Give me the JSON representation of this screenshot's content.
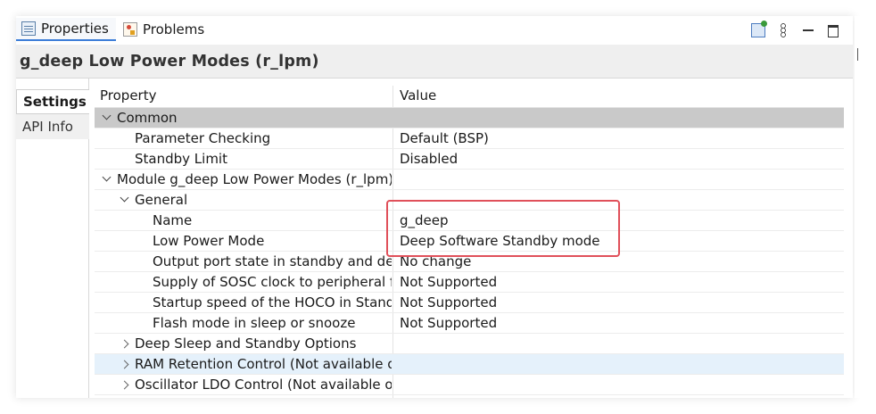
{
  "tabs": {
    "properties": "Properties",
    "problems": "Problems"
  },
  "toolbar_icons": [
    "pin-icon",
    "view-menu-icon",
    "minimize-icon",
    "maximize-icon"
  ],
  "title": "g_deep Low Power Modes (r_lpm)",
  "side_tabs": [
    "Settings",
    "API Info"
  ],
  "table": {
    "headers": [
      "Property",
      "Value"
    ],
    "rows": [
      {
        "name": "Common",
        "value": ""
      },
      {
        "name": "Parameter Checking",
        "value": "Default (BSP)"
      },
      {
        "name": "Standby Limit",
        "value": "Disabled"
      },
      {
        "name": "Module g_deep Low Power Modes (r_lpm)",
        "value": ""
      },
      {
        "name": "General",
        "value": ""
      },
      {
        "name": "Name",
        "value": "g_deep"
      },
      {
        "name": "Low Power Mode",
        "value": "Deep Software Standby mode"
      },
      {
        "name": "Output port state in standby and dee",
        "value": "No change"
      },
      {
        "name": "Supply of SOSC clock to peripheral fu",
        "value": "Not Supported"
      },
      {
        "name": "Startup speed of the HOCO in Standb",
        "value": "Not Supported"
      },
      {
        "name": "Flash mode in sleep or snooze",
        "value": "Not Supported"
      },
      {
        "name": "Deep Sleep and Standby Options",
        "value": ""
      },
      {
        "name": "RAM Retention Control (Not available o",
        "value": ""
      },
      {
        "name": "Oscillator LDO Control (Not available on",
        "value": ""
      }
    ]
  },
  "colors": {
    "category_row": "#c9c9c9",
    "selected_row": "#e5f1fb",
    "highlight_box": "#e0505a",
    "active_tab_underline": "#3c7dd8"
  }
}
